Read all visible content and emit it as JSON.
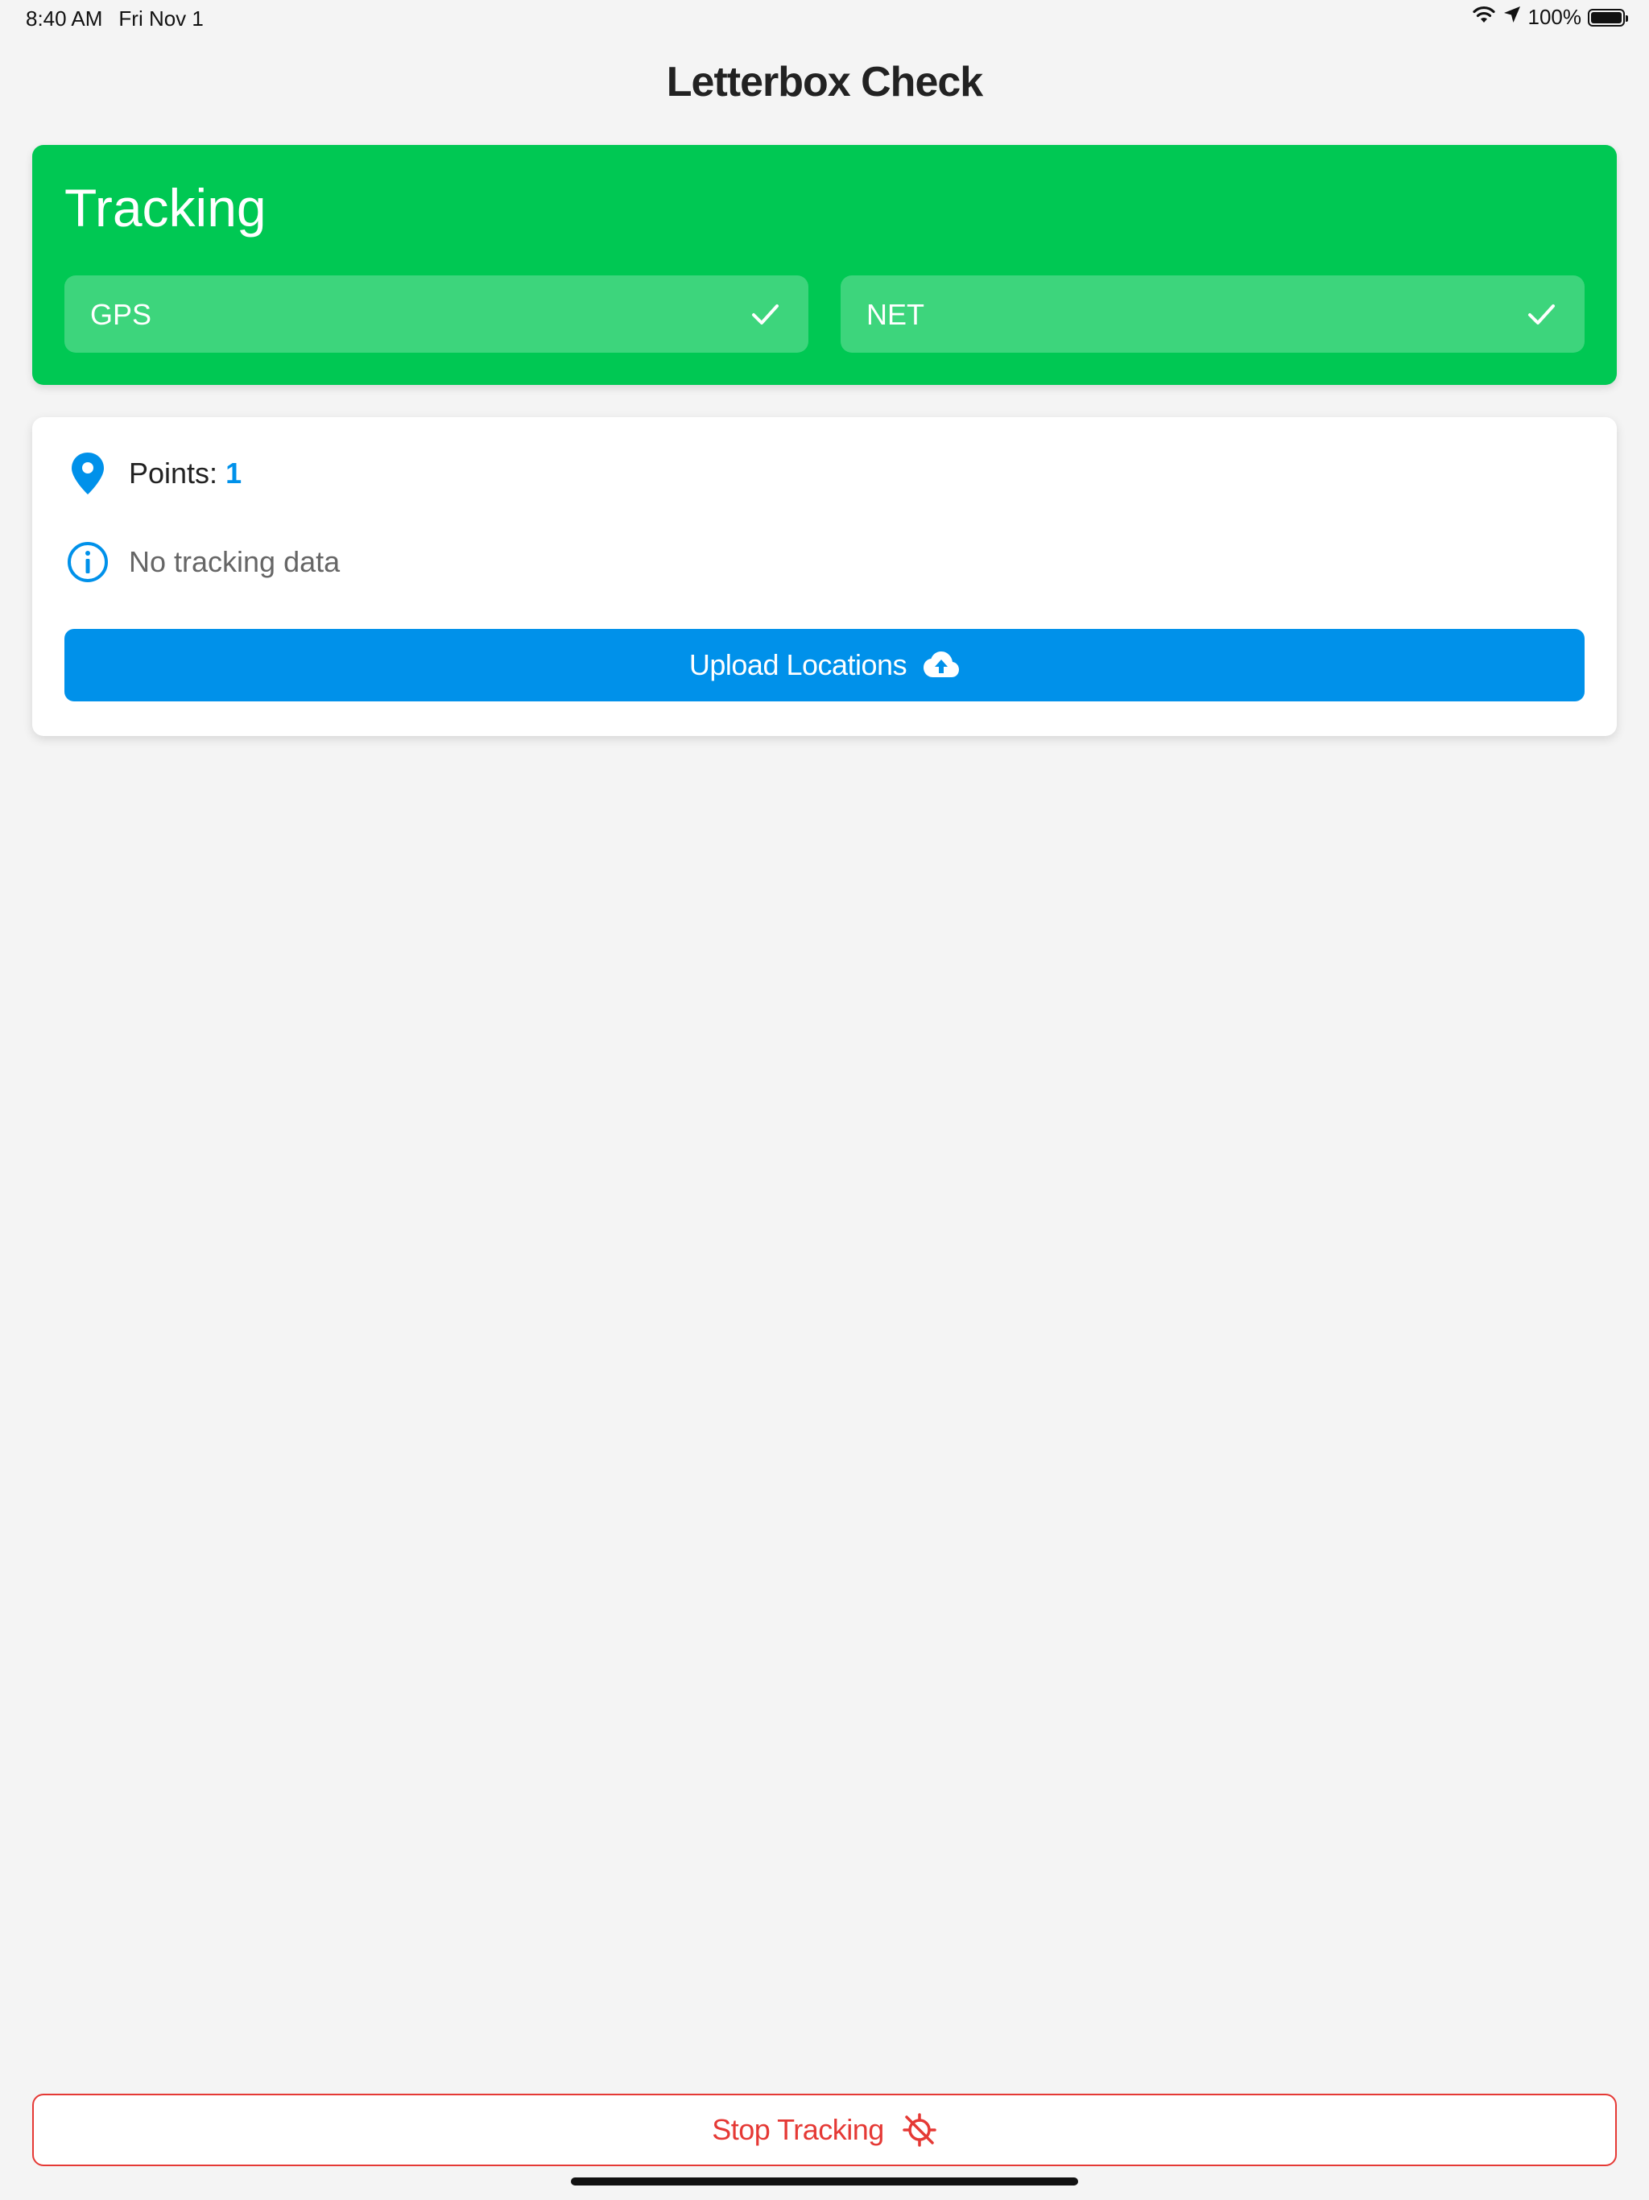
{
  "status_bar": {
    "time": "8:40 AM",
    "date": "Fri Nov 1",
    "battery": "100%",
    "icons": [
      "wifi-icon",
      "location-arrow-icon",
      "battery-icon"
    ]
  },
  "header": {
    "title": "Letterbox Check"
  },
  "tracking_card": {
    "title": "Tracking",
    "color": "#00c853",
    "providers": [
      {
        "label": "GPS",
        "icon": "checkmark-icon"
      },
      {
        "label": "NET",
        "icon": "checkmark-icon"
      }
    ]
  },
  "info_card": {
    "points_label": "Points:",
    "points_value": "1",
    "points_icon": "map-pin-icon",
    "message": "No tracking data",
    "message_icon": "info-circle-icon",
    "upload_button_label": "Upload Locations",
    "upload_icon": "cloud-upload-icon",
    "accent_color": "#0091ea"
  },
  "footer": {
    "stop_button_label": "Stop Tracking",
    "stop_icon": "location-off-icon",
    "stop_color": "#e53935"
  }
}
